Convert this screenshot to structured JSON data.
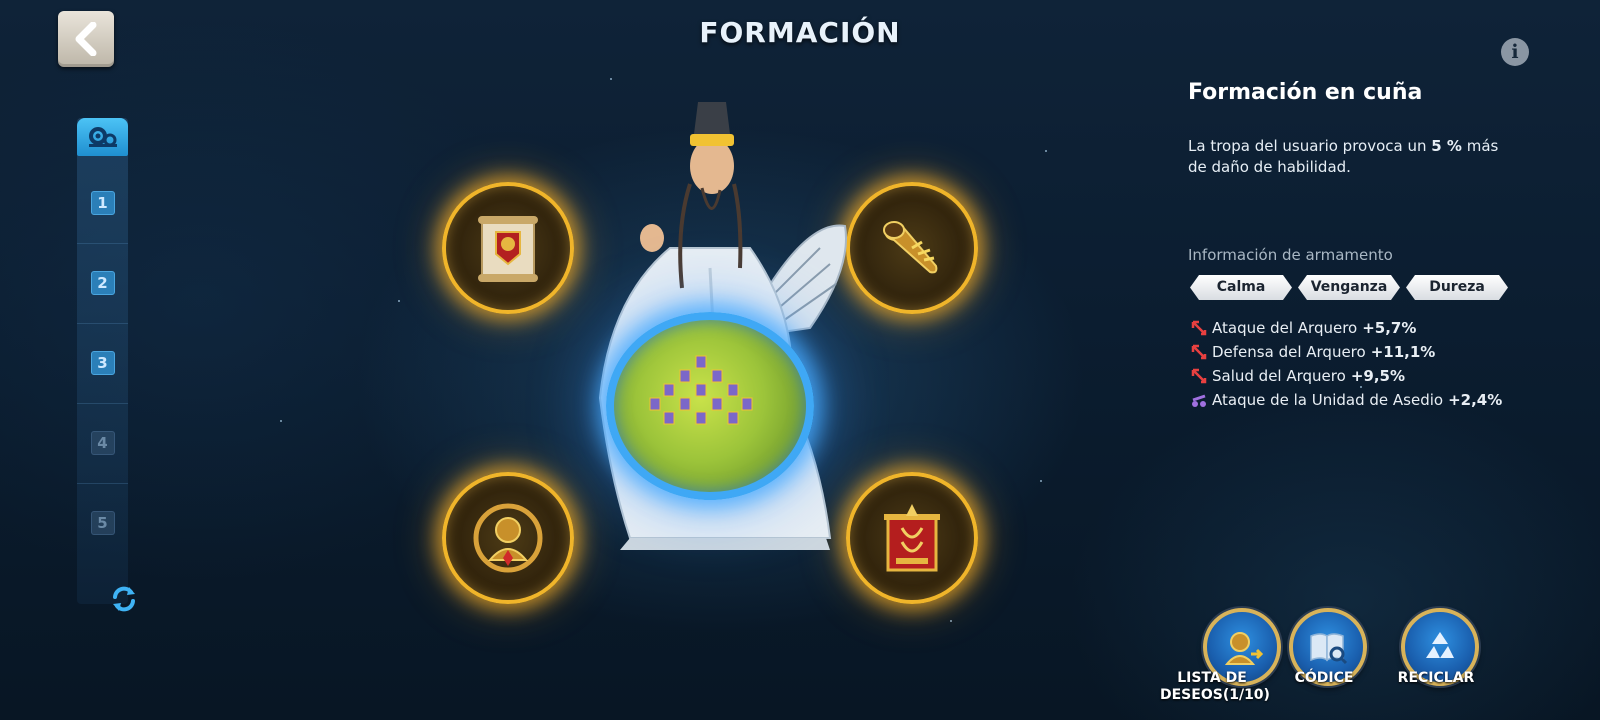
{
  "header": {
    "title": "FORMACIÓN"
  },
  "sidebar": {
    "slots": [
      {
        "label": "1",
        "active": true
      },
      {
        "label": "2",
        "active": true
      },
      {
        "label": "3",
        "active": true
      },
      {
        "label": "4",
        "active": false
      },
      {
        "label": "5",
        "active": false
      }
    ]
  },
  "formation": {
    "name": "Formación en cuña",
    "desc_before": "La tropa del usuario provoca un ",
    "desc_bold": "5 %",
    "desc_after": " más de daño de habilidad."
  },
  "armament": {
    "title": "Información de armamento",
    "tags": [
      "Calma",
      "Venganza",
      "Dureza"
    ],
    "stats": [
      {
        "label": "Ataque del Arquero",
        "value": "+5,7%",
        "icon": "archer-icon",
        "color": "#e84040"
      },
      {
        "label": "Defensa del Arquero",
        "value": "+11,1%",
        "icon": "archer-icon",
        "color": "#e84040"
      },
      {
        "label": "Salud del Arquero",
        "value": "+9,5%",
        "icon": "archer-icon",
        "color": "#e84040"
      },
      {
        "label": "Ataque de la Unidad de Asedio",
        "value": "+2,4%",
        "icon": "siege-icon",
        "color": "#a070e0"
      }
    ]
  },
  "equipment": [
    {
      "name": "banner-scroll-icon"
    },
    {
      "name": "golden-horn-icon"
    },
    {
      "name": "golden-bust-icon"
    },
    {
      "name": "red-banner-icon"
    }
  ],
  "buttons": {
    "wishlist_line1": "LISTA DE",
    "wishlist_line2": "DESEOS(1/10)",
    "codex": "CÓDICE",
    "recycle": "RECICLAR"
  },
  "colors": {
    "accent_gold": "#f0b52a",
    "accent_blue": "#3fa8f5",
    "background": "#0f2338"
  }
}
